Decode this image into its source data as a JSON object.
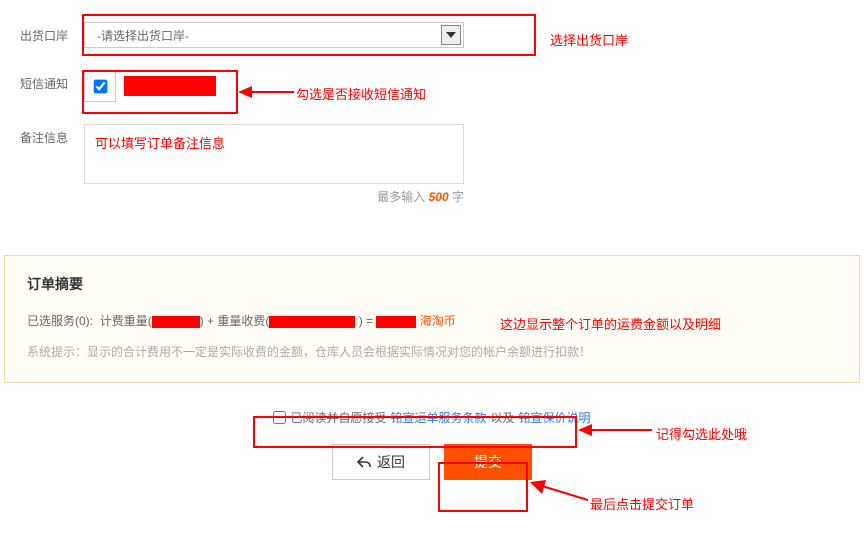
{
  "form": {
    "port": {
      "label": "出货口岸",
      "placeholder": "-请选择出货口岸-"
    },
    "sms": {
      "label": "短信通知",
      "checked": true
    },
    "note": {
      "label": "备注信息"
    }
  },
  "note_placeholder": "可以填写订单备注信息",
  "char_limit": {
    "prefix": "最多输入",
    "num": "500",
    "suffix": "字"
  },
  "annotations": {
    "port": "选择出货口岸",
    "sms": "勾选是否接收短信通知",
    "summary": "这边显示整个订单的运费金额以及明细",
    "agree": "记得勾选此处哦",
    "submit": "最后点击提交订单"
  },
  "summary": {
    "title": "订单摘要",
    "services_label": "已选服务(0):",
    "weight_label": "计费重量",
    "plus": " + ",
    "fee_label": "重量收费",
    "equals_close": ") = ",
    "currency": "海淘币",
    "tip": "系统提示：显示的合计费用不一定是实际收费的金额，仓库人员会根据实际情况对您的帐户余额进行扣款！"
  },
  "agree": {
    "text1": "已阅读并自愿接受",
    "link1": "铭宣运单服务条款",
    "text2": "以及",
    "link2": "铭宣保价说明"
  },
  "buttons": {
    "back": "返回",
    "submit": "提交"
  }
}
